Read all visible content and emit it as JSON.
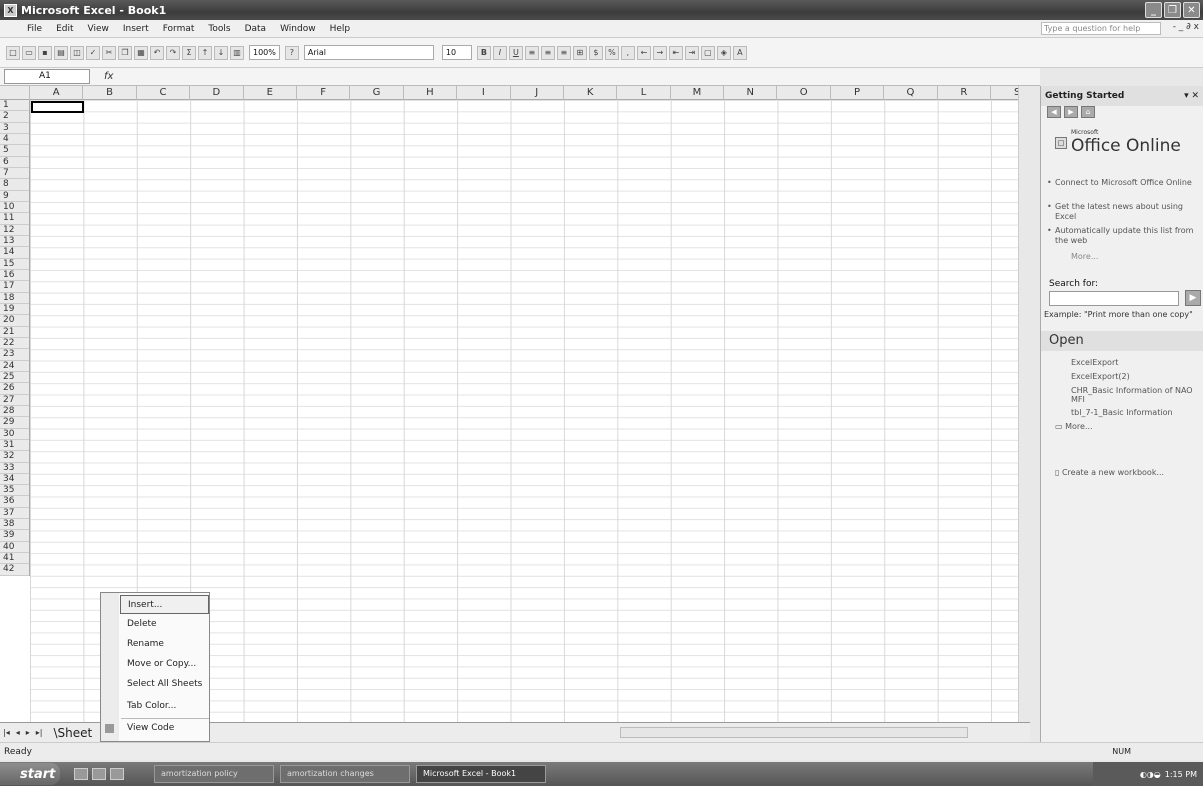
{
  "window": {
    "title": "Microsoft Excel - Book1"
  },
  "menubar": {
    "items": [
      "File",
      "Edit",
      "View",
      "Insert",
      "Format",
      "Tools",
      "Data",
      "Window",
      "Help"
    ],
    "ask_placeholder": "Type a question for help",
    "doc_controls": "- _ ∂ x"
  },
  "toolbar": {
    "zoom": "100%",
    "font": "Arial",
    "size": "10",
    "bold": "B",
    "italic": "I",
    "underline": "U",
    "currency": "$",
    "percent": "%",
    "sum": "Σ"
  },
  "formula": {
    "name_box": "A1",
    "fx": "fx"
  },
  "columns": [
    "A",
    "B",
    "C",
    "D",
    "E",
    "F",
    "G",
    "H",
    "I",
    "J",
    "K",
    "L",
    "M",
    "N",
    "O",
    "P",
    "Q",
    "R",
    "S"
  ],
  "rows": [
    "1",
    "2",
    "3",
    "4",
    "5",
    "6",
    "7",
    "8",
    "9",
    "10",
    "11",
    "12",
    "13",
    "14",
    "15",
    "16",
    "17",
    "18",
    "19",
    "20",
    "21",
    "22",
    "23",
    "24",
    "25",
    "26",
    "27",
    "28",
    "29",
    "30",
    "31",
    "32",
    "33",
    "34",
    "35",
    "36",
    "37",
    "38",
    "39",
    "40",
    "41",
    "42"
  ],
  "sheet_tabs": {
    "nav": [
      "|◂",
      "◂",
      "▸",
      "▸|"
    ],
    "tab_label": "\\Sheet"
  },
  "context_menu": {
    "items": [
      "Insert...",
      "Delete",
      "Rename",
      "Move or Copy...",
      "Select All Sheets",
      "Tab Color...",
      "View Code"
    ]
  },
  "status": {
    "text": "Ready",
    "indicator": "NUM"
  },
  "taskbar": {
    "start": "start",
    "tasks": [
      "amortization policy",
      "amortization changes",
      "Microsoft Excel - Book1"
    ],
    "clock": "1:15 PM"
  },
  "task_pane": {
    "title": "Getting Started",
    "logo_small": "Microsoft",
    "logo": "Office Online",
    "online_links": [
      "Connect to Microsoft Office Online",
      "Get the latest news about using Excel",
      "Automatically update this list from the web"
    ],
    "more": "More...",
    "search_label": "Search for:",
    "example": "Example: \"Print more than one copy\"",
    "open_header": "Open",
    "open_files": [
      "ExcelExport",
      "ExcelExport(2)",
      "CHR_Basic Information of NAO MFI",
      "tbl_7-1_Basic Information"
    ],
    "open_more": "More...",
    "create_new": "Create a new workbook..."
  }
}
